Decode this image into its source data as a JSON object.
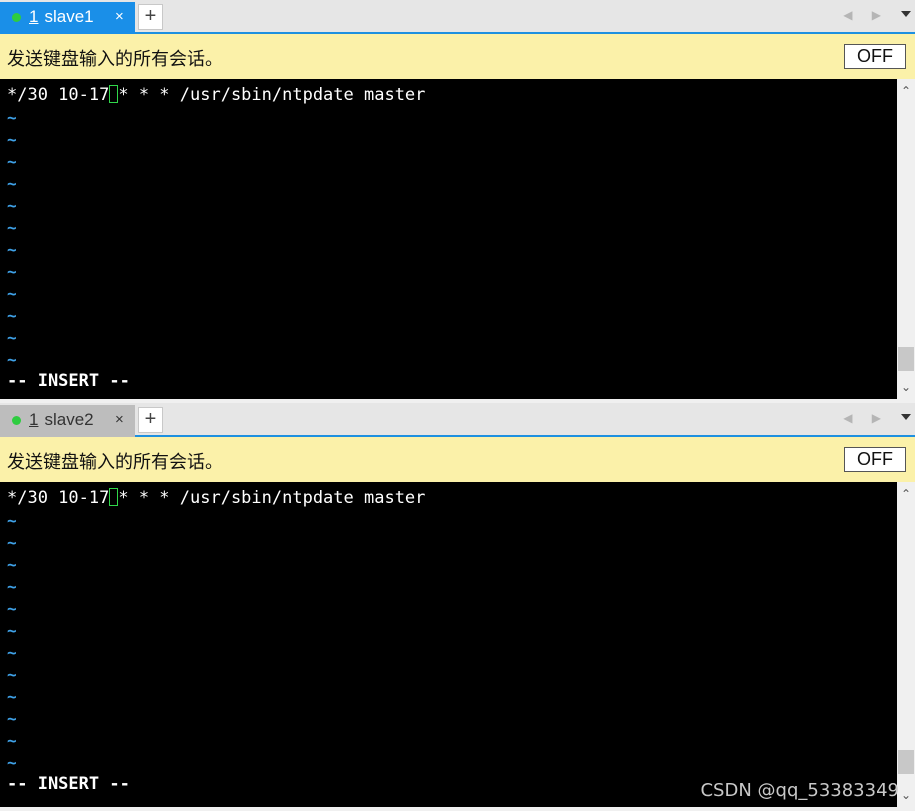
{
  "panes": [
    {
      "tab": {
        "number": "1",
        "name": "slave1",
        "close": "×"
      },
      "broadcast": {
        "text": "发送键盘输入的所有会话。",
        "toggle": "OFF"
      },
      "terminal": {
        "line_before_cursor": "*/30 10-17",
        "line_after_cursor": "* * * /usr/sbin/ntpdate master",
        "tilde": "~",
        "mode": "-- INSERT --"
      }
    },
    {
      "tab": {
        "number": "1",
        "name": "slave2",
        "close": "×"
      },
      "broadcast": {
        "text": "发送键盘输入的所有会话。",
        "toggle": "OFF"
      },
      "terminal": {
        "line_before_cursor": "*/30 10-17",
        "line_after_cursor": "* * * /usr/sbin/ntpdate master",
        "tilde": "~",
        "mode": "-- INSERT --"
      }
    }
  ],
  "tab_add": "+",
  "nav_arrows": "◀ ▶",
  "colors": {
    "active_tab": "#1a8fe8",
    "broadcast_bar": "#fbf1a9",
    "tilde": "#3fa2e8",
    "cursor": "#30d64a"
  },
  "watermark": "CSDN @qq_53383349"
}
